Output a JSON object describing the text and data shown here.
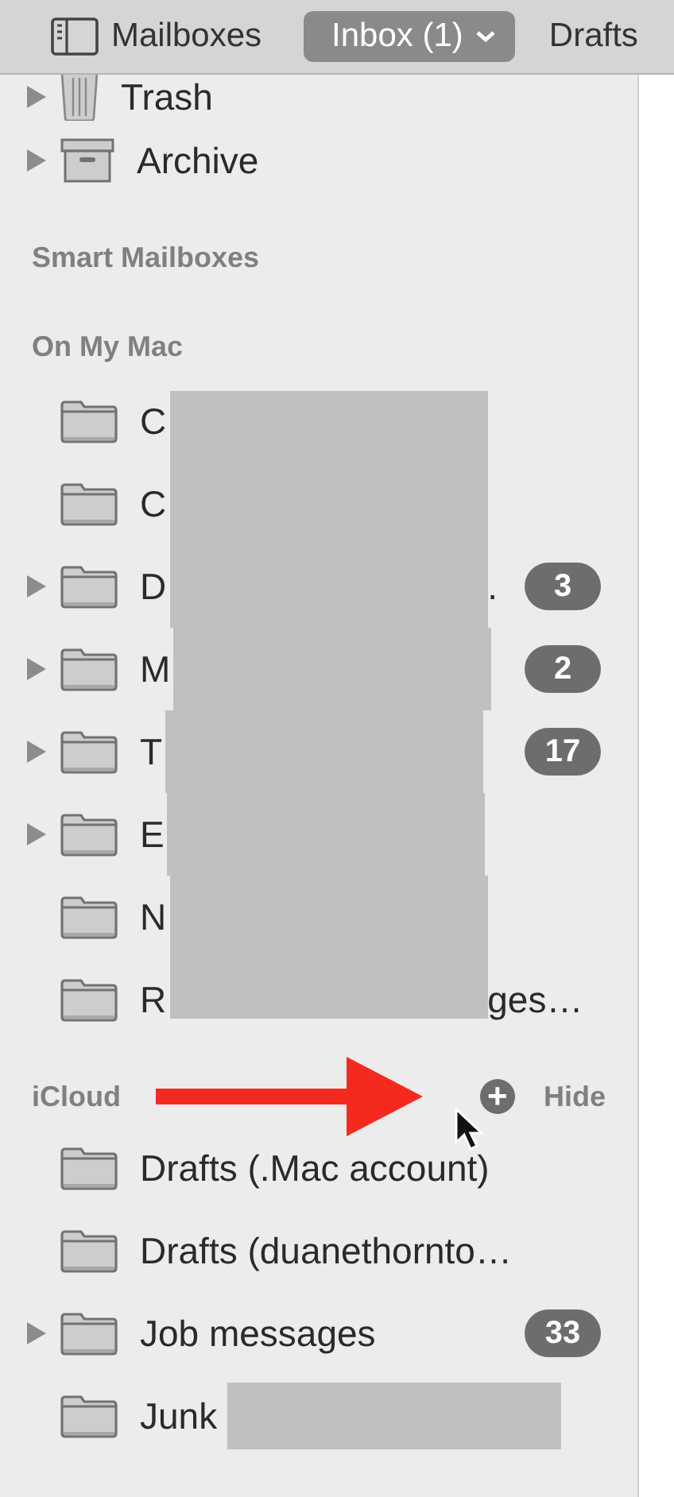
{
  "toolbar": {
    "sidebar_button": "Mailboxes",
    "inbox_button": "Inbox (1)",
    "drafts_button": "Drafts"
  },
  "top_items": [
    {
      "label": "Trash",
      "expandable": true
    },
    {
      "label": "Archive",
      "expandable": true
    }
  ],
  "smart_mailboxes": {
    "title": "Smart Mailboxes"
  },
  "on_my_mac": {
    "title": "On My Mac",
    "items": [
      {
        "label": "C",
        "redacted": true,
        "expandable": false
      },
      {
        "label": "C",
        "redacted": true,
        "expandable": false
      },
      {
        "label": "D",
        "redacted": true,
        "tail": ".",
        "expandable": true,
        "badge": "3"
      },
      {
        "label": "M",
        "redacted": true,
        "expandable": true,
        "badge": "2"
      },
      {
        "label": "T",
        "redacted": true,
        "expandable": true,
        "badge": "17"
      },
      {
        "label": "E",
        "redacted": true,
        "expandable": true
      },
      {
        "label": "N",
        "redacted": true,
        "expandable": false
      },
      {
        "label": "R",
        "redacted": true,
        "tail": "ges…",
        "expandable": false
      }
    ]
  },
  "icloud": {
    "title": "iCloud",
    "add": "+",
    "hide": "Hide",
    "annotation_arrow": true,
    "cursor": true,
    "items": [
      {
        "label": "Drafts (.Mac account)",
        "expandable": false
      },
      {
        "label": "Drafts (duanethornto…",
        "expandable": false
      },
      {
        "label": "Job messages",
        "expandable": true,
        "badge": "33"
      },
      {
        "label": "Junk",
        "expandable": false,
        "redacted": true
      }
    ]
  }
}
